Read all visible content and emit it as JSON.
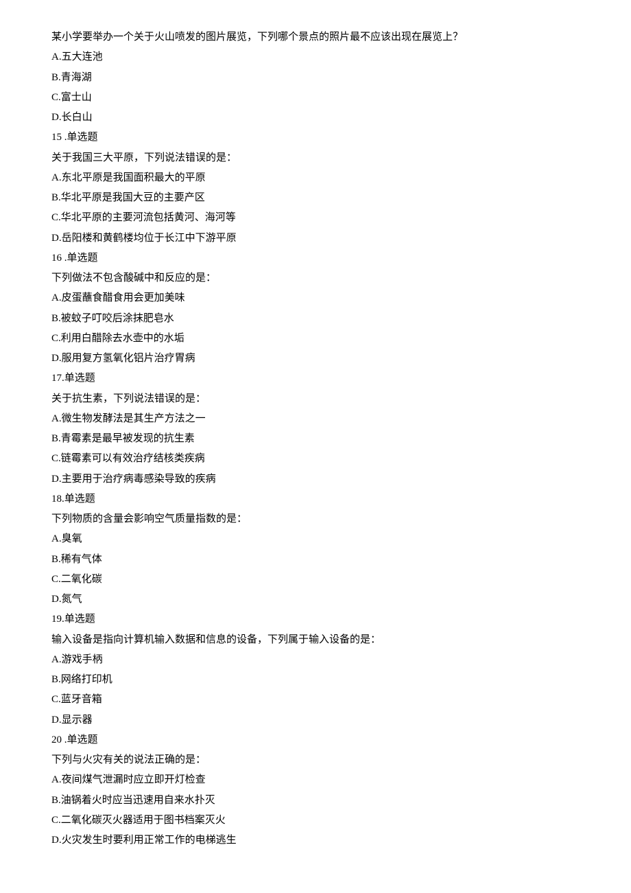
{
  "lines": [
    "某小学要举办一个关于火山喷发的图片展览，下列哪个景点的照片最不应该出现在展览上？",
    "A.五大连池",
    "B.青海湖",
    "C.富士山",
    "D.长白山",
    "15 .单选题",
    "关于我国三大平原，下列说法错误的是：",
    "A.东北平原是我国面积最大的平原",
    "B.华北平原是我国大豆的主要产区",
    "C.华北平原的主要河流包括黄河、海河等",
    "D.岳阳楼和黄鹤楼均位于长江中下游平原",
    "16 .单选题",
    "下列做法不包含酸碱中和反应的是：",
    "A.皮蛋蘸食醋食用会更加美味",
    "B.被蚊子叮咬后涂抹肥皂水",
    "C.利用白醋除去水壶中的水垢",
    "D.服用复方氢氧化铝片治疗胃病",
    "17.单选题",
    "关于抗生素，下列说法错误的是：",
    "A.微生物发酵法是其生产方法之一",
    "B.青霉素是最早被发现的抗生素",
    "C.链霉素可以有效治疗结核类疾病",
    "D.主要用于治疗病毒感染导致的疾病",
    "18.单选题",
    "下列物质的含量会影响空气质量指数的是：",
    "A.臭氧",
    "B.稀有气体",
    "C.二氧化碳",
    "D.氮气",
    "19.单选题",
    "输入设备是指向计算机输入数据和信息的设备，下列属于输入设备的是：",
    "A.游戏手柄",
    "B.网络打印机",
    "C.蓝牙音箱",
    "D.显示器",
    "20 .单选题",
    "下列与火灾有关的说法正确的是：",
    "A.夜间煤气泄漏时应立即开灯检查",
    "B.油锅着火时应当迅速用自来水扑灭",
    "C.二氧化碳灭火器适用于图书档案灭火",
    "D.火灾发生时要利用正常工作的电梯逃生"
  ]
}
